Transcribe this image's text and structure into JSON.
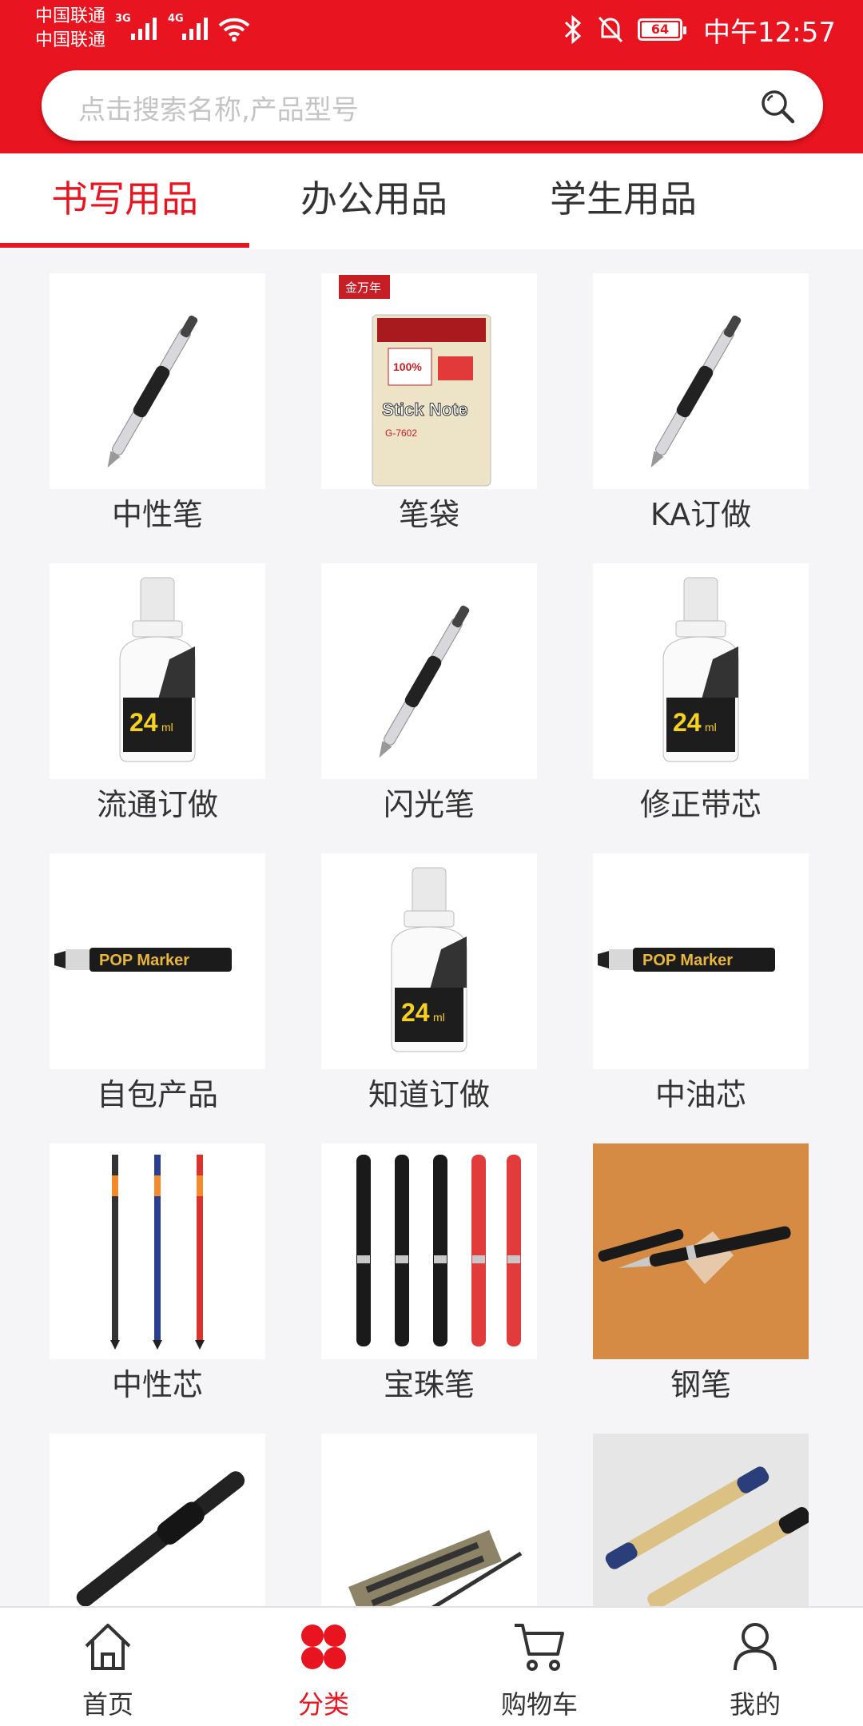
{
  "status_bar": {
    "carrier_1": "中国联通",
    "carrier_2": "中国联通",
    "net_1": "3G",
    "net_2": "4G",
    "battery": "64",
    "time": "中午12:57"
  },
  "search": {
    "placeholder": "点击搜索名称,产品型号"
  },
  "tabs": [
    {
      "label": "书写用品",
      "active": true
    },
    {
      "label": "办公用品",
      "active": false
    },
    {
      "label": "学生用品",
      "active": false
    }
  ],
  "categories": [
    {
      "label": "中性笔",
      "image": "gel-pen"
    },
    {
      "label": "笔袋",
      "image": "sticky-note-pack"
    },
    {
      "label": "KA订做",
      "image": "gel-pen"
    },
    {
      "label": "流通订做",
      "image": "correction-fluid"
    },
    {
      "label": "闪光笔",
      "image": "gel-pen"
    },
    {
      "label": "修正带芯",
      "image": "correction-fluid"
    },
    {
      "label": "自包产品",
      "image": "marker"
    },
    {
      "label": "知道订做",
      "image": "correction-fluid"
    },
    {
      "label": "中油芯",
      "image": "marker"
    },
    {
      "label": "中性芯",
      "image": "refills"
    },
    {
      "label": "宝珠笔",
      "image": "rollerball-pens"
    },
    {
      "label": "钢笔",
      "image": "fountain-pen"
    },
    {
      "label": "",
      "image": "black-gel-pen"
    },
    {
      "label": "",
      "image": "pen-set"
    },
    {
      "label": "",
      "image": "twin-markers"
    }
  ],
  "product_text": {
    "sticky_brand": "金万年",
    "sticky_main": "Stick Note",
    "sticky_model": "G-7602",
    "sticky_pct": "100%",
    "fluid_volume": "24",
    "fluid_unit": "ml",
    "marker_text": "POP Marker"
  },
  "bottom_nav": [
    {
      "label": "首页",
      "icon": "home-icon",
      "active": false
    },
    {
      "label": "分类",
      "icon": "category-icon",
      "active": true
    },
    {
      "label": "购物车",
      "icon": "cart-icon",
      "active": false
    },
    {
      "label": "我的",
      "icon": "profile-icon",
      "active": false
    }
  ],
  "colors": {
    "brand_red": "#e8141f",
    "text": "#333333",
    "placeholder": "#c4c4c4"
  }
}
